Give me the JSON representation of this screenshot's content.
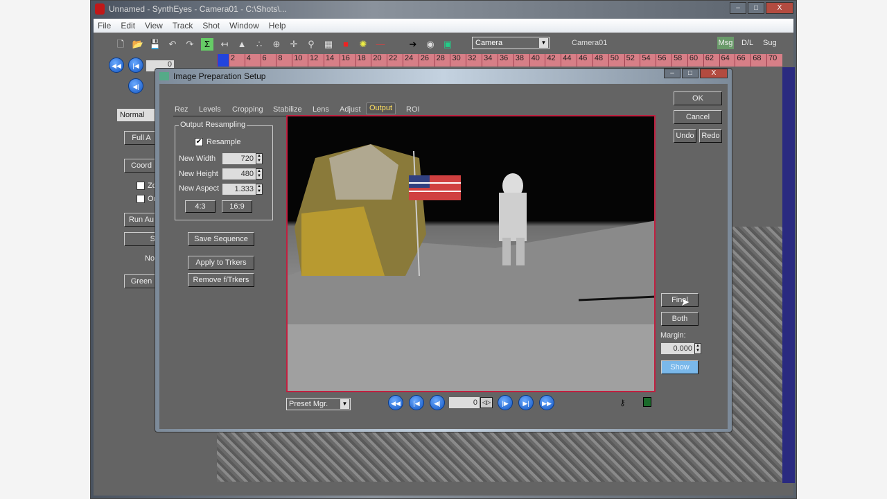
{
  "app": {
    "title": "Unnamed - SynthEyes - Camera01 - C:\\Shots\\...",
    "menu": [
      "File",
      "Edit",
      "View",
      "Track",
      "Shot",
      "Window",
      "Help"
    ],
    "camera_select": "Camera",
    "camera_name": "Camera01",
    "right_tabs": [
      "Msg",
      "D/L",
      "Sug"
    ],
    "timeline_frames": [
      "2",
      "4",
      "6",
      "8",
      "10",
      "12",
      "14",
      "16",
      "18",
      "20",
      "22",
      "24",
      "26",
      "28",
      "30",
      "32",
      "34",
      "36",
      "38",
      "40",
      "42",
      "44",
      "46",
      "48",
      "50",
      "52",
      "54",
      "56",
      "58",
      "60",
      "62",
      "64",
      "66",
      "68",
      "70"
    ],
    "frame_value": "0",
    "left_panel": {
      "mode_select": "Normal Moti",
      "buttons": [
        "Full A",
        "Coord",
        "Run Au",
        "S",
        "Green"
      ],
      "checkboxes": [
        "Zo",
        "On"
      ],
      "text": "No"
    }
  },
  "dialog": {
    "title": "Image Preparation Setup",
    "tabs": [
      "Rez",
      "Levels",
      "Cropping",
      "Stabilize",
      "Lens",
      "Adjust",
      "Output",
      "ROI"
    ],
    "active_tab": "Output",
    "group_label": "Output Resampling",
    "resample_label": "Resample",
    "resample_checked": true,
    "new_width_label": "New Width",
    "new_width": "720",
    "new_height_label": "New Height",
    "new_height": "480",
    "new_aspect_label": "New Aspect",
    "new_aspect": "1.333",
    "aspect_43": "4:3",
    "aspect_169": "16:9",
    "save_sequence": "Save Sequence",
    "apply_trkers": "Apply to Trkers",
    "remove_trkers": "Remove f/Trkers",
    "ok": "OK",
    "cancel": "Cancel",
    "undo": "Undo",
    "redo": "Redo",
    "final": "Final",
    "both": "Both",
    "margin_label": "Margin:",
    "margin": "0.000",
    "show": "Show",
    "preset": "Preset Mgr.",
    "frame": "0"
  }
}
